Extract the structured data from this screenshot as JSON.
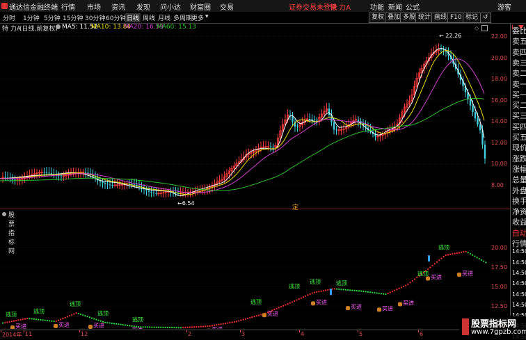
{
  "topbar": {
    "app_title": "通达信金融终端",
    "menus": [
      "行情",
      "市场",
      "资讯",
      "发现",
      "问小达",
      "财富圈",
      "交易"
    ],
    "notice": "证券交易未登录",
    "stock": "特 力A",
    "right_menus": [
      "功能",
      "新闻",
      "公式",
      "游客"
    ]
  },
  "toolbar": {
    "periods": [
      "分时",
      "1分钟",
      "5分钟",
      "15分钟",
      "30分钟",
      "60分钟",
      "日线",
      "周线",
      "月线",
      "多周期",
      "更多"
    ],
    "active_period": "日线",
    "right_buttons": [
      "复权",
      "叠加",
      "多股",
      "统计",
      "画线",
      "F10",
      "标记",
      "↺"
    ]
  },
  "info": {
    "stock_name": "特 力A",
    "mode": "(日线,前复权)",
    "ma5": "MA5: 11.52",
    "ma10": "MA10: 13.84",
    "ma20": "MA20: 16.59",
    "ma60": "MA60: 15.13"
  },
  "colors": {
    "ma5": "#ffffff",
    "ma10": "#f0e000",
    "ma20": "#d040d0",
    "ma60": "#30c030",
    "up": "#ff3c3c",
    "down": "#40d0e0"
  },
  "price_axis": [
    "22.00",
    "20.00",
    "18.00",
    "16.00",
    "14.00",
    "12.00",
    "10.00",
    "8.00"
  ],
  "annotations": {
    "high": "22.26",
    "low": "6.54",
    "ding": "定"
  },
  "sub_title": "股票指标网",
  "sub_axis": [
    "20.00",
    "17.50",
    "15.00",
    "12.50",
    "10.00"
  ],
  "signals": {
    "escape": "逃顶",
    "buy": "买进"
  },
  "date_axis": [
    "2014年",
    "11",
    "12",
    "2",
    "3",
    "4",
    "5",
    "6"
  ],
  "side_panel": [
    "委比",
    "卖五",
    "卖四",
    "卖三",
    "卖二",
    "卖一",
    "买一",
    "买二",
    "买三",
    "买四",
    "买五",
    "现价",
    "涨跌",
    "涨幅",
    "总量",
    "外盘",
    "换手",
    "净资",
    "收益",
    "自动",
    "行情",
    "14:50",
    "14:50",
    "14:50",
    "14:50",
    "14:50",
    "14:50",
    "14:50",
    "14:50",
    "14:50"
  ],
  "side_top": "L",
  "watermark": {
    "title": "股票指标网",
    "url": "www.7gpzb.com"
  }
}
